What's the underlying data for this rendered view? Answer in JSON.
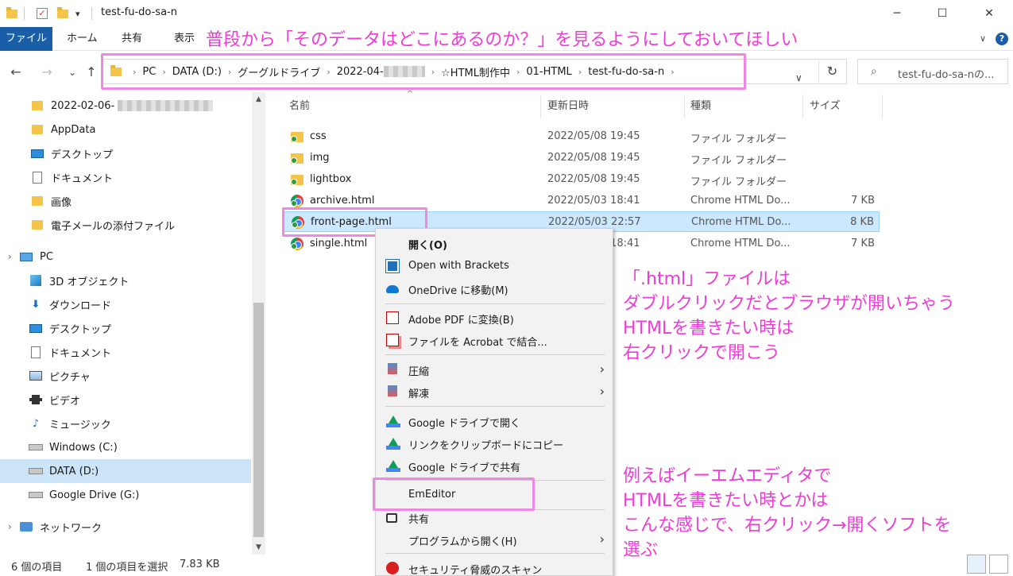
{
  "window": {
    "title": "test-fu-do-sa-n",
    "minimize": "─",
    "maximize": "☐",
    "close": "✕",
    "qa_dropdown": "▾"
  },
  "ribbon": {
    "tabs": [
      "ファイル",
      "ホーム",
      "共有",
      "表示"
    ]
  },
  "nav": {
    "back": "←",
    "forward": "→",
    "recent": "⌄",
    "up": "↑",
    "breadcrumb": [
      "PC",
      "DATA (D:)",
      "グーグルドライブ",
      "2022-04-",
      "☆HTML制作中",
      "01-HTML",
      "test-fu-do-sa-n"
    ],
    "breadcrumb_sep": "›",
    "dropdown": "∨",
    "refresh": "↻",
    "search_icon": "⌕",
    "search_placeholder": "test-fu-do-sa-nの..."
  },
  "sidebar": {
    "items": [
      {
        "label": "2022-02-06-",
        "icon": "folder-icon"
      },
      {
        "label": "AppData",
        "icon": "folder-icon"
      },
      {
        "label": "デスクトップ",
        "icon": "desktop-icon"
      },
      {
        "label": "ドキュメント",
        "icon": "document-icon"
      },
      {
        "label": "画像",
        "icon": "folder-icon"
      },
      {
        "label": "電子メールの添付ファイル",
        "icon": "folder-icon"
      },
      {
        "label": "PC",
        "icon": "pc-icon"
      },
      {
        "label": "3D オブジェクト",
        "icon": "3d-objects-icon"
      },
      {
        "label": "ダウンロード",
        "icon": "download-icon"
      },
      {
        "label": "デスクトップ",
        "icon": "desktop-icon"
      },
      {
        "label": "ドキュメント",
        "icon": "document-icon"
      },
      {
        "label": "ピクチャ",
        "icon": "pictures-icon"
      },
      {
        "label": "ビデオ",
        "icon": "video-icon"
      },
      {
        "label": "ミュージック",
        "icon": "music-icon"
      },
      {
        "label": "Windows (C:)",
        "icon": "drive-icon"
      },
      {
        "label": "DATA (D:)",
        "icon": "drive-icon"
      },
      {
        "label": "Google Drive (G:)",
        "icon": "drive-icon"
      },
      {
        "label": "ネットワーク",
        "icon": "network-icon"
      }
    ],
    "pc_expand": "›",
    "network_expand": "›",
    "scroll_up": "▲",
    "scroll_down": "▼"
  },
  "filelist": {
    "columns": [
      "名前",
      "更新日時",
      "種類",
      "サイズ"
    ],
    "sort_indicator": "^",
    "rows": [
      {
        "name": "css",
        "date": "2022/05/08 19:45",
        "type": "ファイル フォルダー",
        "size": "",
        "icon": "folder-icon"
      },
      {
        "name": "img",
        "date": "2022/05/08 19:45",
        "type": "ファイル フォルダー",
        "size": "",
        "icon": "folder-icon"
      },
      {
        "name": "lightbox",
        "date": "2022/05/08 19:45",
        "type": "ファイル フォルダー",
        "size": "",
        "icon": "folder-icon"
      },
      {
        "name": "archive.html",
        "date": "2022/05/03 18:41",
        "type": "Chrome HTML Do...",
        "size": "7 KB",
        "icon": "chrome-icon"
      },
      {
        "name": "front-page.html",
        "date": "2022/05/03 22:57",
        "type": "Chrome HTML Do...",
        "size": "8 KB",
        "icon": "chrome-icon"
      },
      {
        "name": "single.html",
        "date": "2022/05/03 18:41",
        "type": "Chrome HTML Do...",
        "size": "7 KB",
        "icon": "chrome-icon"
      }
    ]
  },
  "context_menu": {
    "items": [
      {
        "label": "開く(O)",
        "icon": "",
        "submenu": false
      },
      {
        "label": "Open with Brackets",
        "icon": "brackets-icon",
        "submenu": false
      },
      {
        "label": "OneDrive に移動(M)",
        "icon": "onedrive-icon",
        "submenu": false
      },
      {
        "label": "Adobe PDF に変換(B)",
        "icon": "adobe-pdf-icon",
        "submenu": false
      },
      {
        "label": "ファイルを Acrobat で結合...",
        "icon": "acrobat-combine-icon",
        "submenu": false
      },
      {
        "label": "圧縮",
        "icon": "compress-icon",
        "submenu": true
      },
      {
        "label": "解凍",
        "icon": "extract-icon",
        "submenu": true
      },
      {
        "label": "Google ドライブで開く",
        "icon": "google-drive-icon",
        "submenu": false
      },
      {
        "label": "リンクをクリップボードにコピー",
        "icon": "google-drive-icon",
        "submenu": false
      },
      {
        "label": "Google ドライブで共有",
        "icon": "google-drive-icon",
        "submenu": false
      },
      {
        "label": "EmEditor",
        "icon": "",
        "submenu": false
      },
      {
        "label": "共有",
        "icon": "share-icon",
        "submenu": false
      },
      {
        "label": "プログラムから開く(H)",
        "icon": "",
        "submenu": true
      },
      {
        "label": "セキュリティ脅威のスキャン",
        "icon": "security-scan-icon",
        "submenu": false
      }
    ],
    "submenu_arrow": "›"
  },
  "status": {
    "count": "6 個の項目",
    "selected": "1 個の項目を選択",
    "size": "7.83 KB"
  },
  "annotations": {
    "top": "普段から「そのデータはどこにあるのか？」を見るようにしておいてほしい",
    "middle": [
      ".html」ファイルは",
      "ダブルクリックだとブラウザが開いちゃう",
      "HTMLを書きたい時は",
      "右クリックで開こう"
    ],
    "middle_prefix": "「",
    "bottom": [
      "例えばイーエムエディタで",
      "HTMLを書きたい時とかは",
      "こんな感じで、右クリック→開くソフトを",
      "選ぶ"
    ]
  },
  "colors": {
    "annotation": "#ef3bd6",
    "highlight_border": "#ee88e2",
    "file_tab": "#1a5ea8",
    "selection": "#cce8ff"
  }
}
